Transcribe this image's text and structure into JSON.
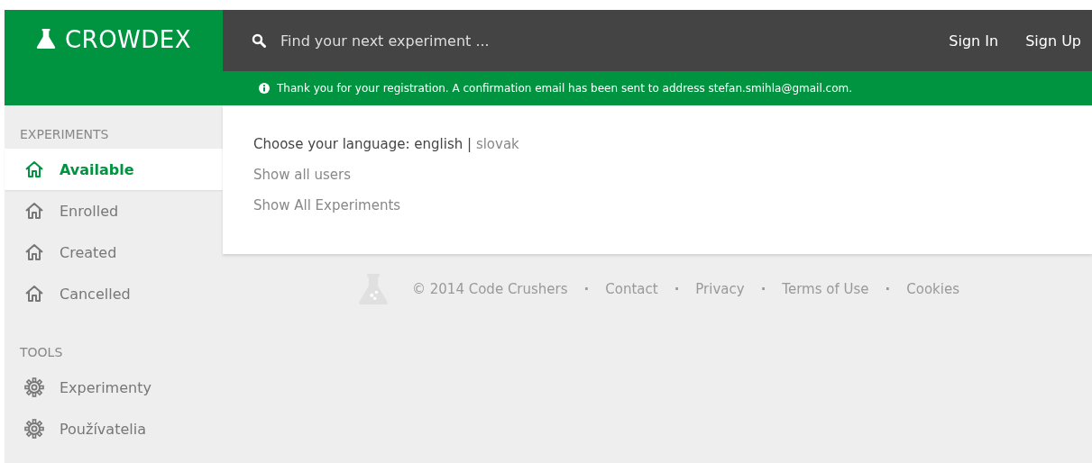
{
  "brand": {
    "name": "CROWDEX"
  },
  "search": {
    "placeholder": "Find your next experiment ..."
  },
  "auth_links": [
    "Sign In",
    "Sign Up"
  ],
  "notice": {
    "text": "Thank you for your registration. A confirmation email has been sent to address stefan.smihla@gmail.com."
  },
  "sidebar": {
    "sections": [
      {
        "title": "EXPERIMENTS",
        "items": [
          {
            "label": "Available",
            "kind": "home",
            "selected": true
          },
          {
            "label": "Enrolled",
            "kind": "home",
            "selected": false
          },
          {
            "label": "Created",
            "kind": "home",
            "selected": false
          },
          {
            "label": "Cancelled",
            "kind": "home",
            "selected": false
          }
        ]
      },
      {
        "title": "TOOLS",
        "items": [
          {
            "label": "Experimenty",
            "kind": "gear",
            "selected": false
          },
          {
            "label": "Používatelia",
            "kind": "gear",
            "selected": false
          }
        ]
      }
    ]
  },
  "content": {
    "language": {
      "label": "Choose your language:",
      "separator": "|",
      "options": [
        {
          "label": "english",
          "selected": true
        },
        {
          "label": "slovak",
          "selected": false
        }
      ]
    },
    "links": [
      "Show all users",
      "Show All Experiments"
    ]
  },
  "footer": {
    "copyright": "© 2014 Code Crushers",
    "separator": "·",
    "links": [
      "Contact",
      "Privacy",
      "Terms of Use",
      "Cookies"
    ]
  }
}
